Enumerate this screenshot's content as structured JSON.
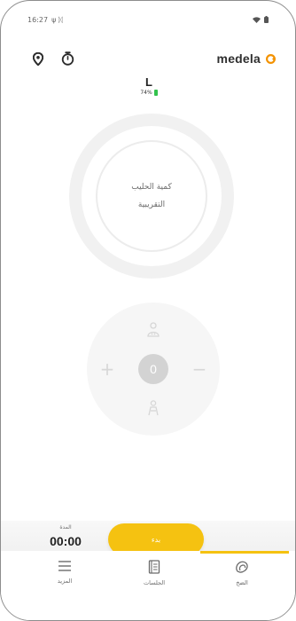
{
  "status_bar": {
    "time": "16:27",
    "notif_icons": "ψ ᛞ"
  },
  "header": {
    "location_icon": "location-pin-icon",
    "timer_icon": "stopwatch-icon",
    "brand_name": "medela",
    "brand_color": "#f39200"
  },
  "side": {
    "label": "L",
    "battery_text": "74%",
    "battery_color": "#33c24d"
  },
  "volume_ring": {
    "line1": "كمية الحليب",
    "line2": "التقريبية"
  },
  "control_pad": {
    "plus_label": "+",
    "minus_label": "−",
    "level_value": "0"
  },
  "session": {
    "timer_label": "المدة",
    "timer_value": "00:00",
    "start_button_label": "بدء",
    "accent_color": "#f5c211"
  },
  "nav": {
    "items": [
      {
        "label": "المزيد",
        "icon": "menu-icon"
      },
      {
        "label": "الجلسات",
        "icon": "journal-icon"
      },
      {
        "label": "الضخ",
        "icon": "pump-icon"
      }
    ],
    "active_index": 2
  }
}
